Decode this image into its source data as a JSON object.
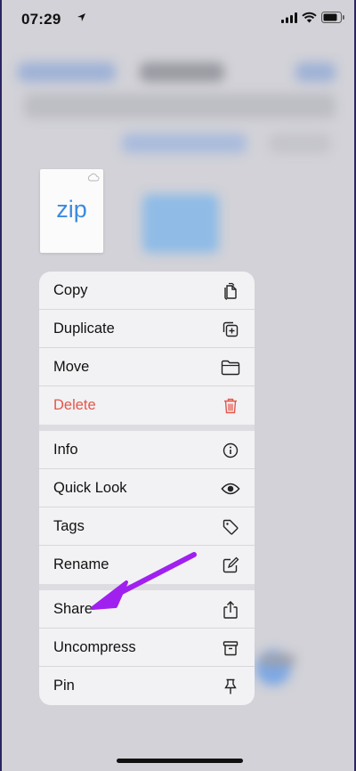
{
  "status_bar": {
    "time": "07:29"
  },
  "preview": {
    "file_label": "zip"
  },
  "menu": {
    "items": [
      {
        "label": "Copy",
        "icon": "copy-icon"
      },
      {
        "label": "Duplicate",
        "icon": "duplicate-icon"
      },
      {
        "label": "Move",
        "icon": "folder-icon"
      },
      {
        "label": "Delete",
        "icon": "trash-icon"
      },
      {
        "label": "Info",
        "icon": "info-icon"
      },
      {
        "label": "Quick Look",
        "icon": "eye-icon"
      },
      {
        "label": "Tags",
        "icon": "tag-icon"
      },
      {
        "label": "Rename",
        "icon": "pencil-square-icon"
      },
      {
        "label": "Share",
        "icon": "share-icon"
      },
      {
        "label": "Uncompress",
        "icon": "archive-icon"
      },
      {
        "label": "Pin",
        "icon": "pin-icon"
      }
    ]
  },
  "colors": {
    "destructive": "#e4564a",
    "accent": "#3a8be0",
    "annotation_arrow": "#a020f0"
  }
}
